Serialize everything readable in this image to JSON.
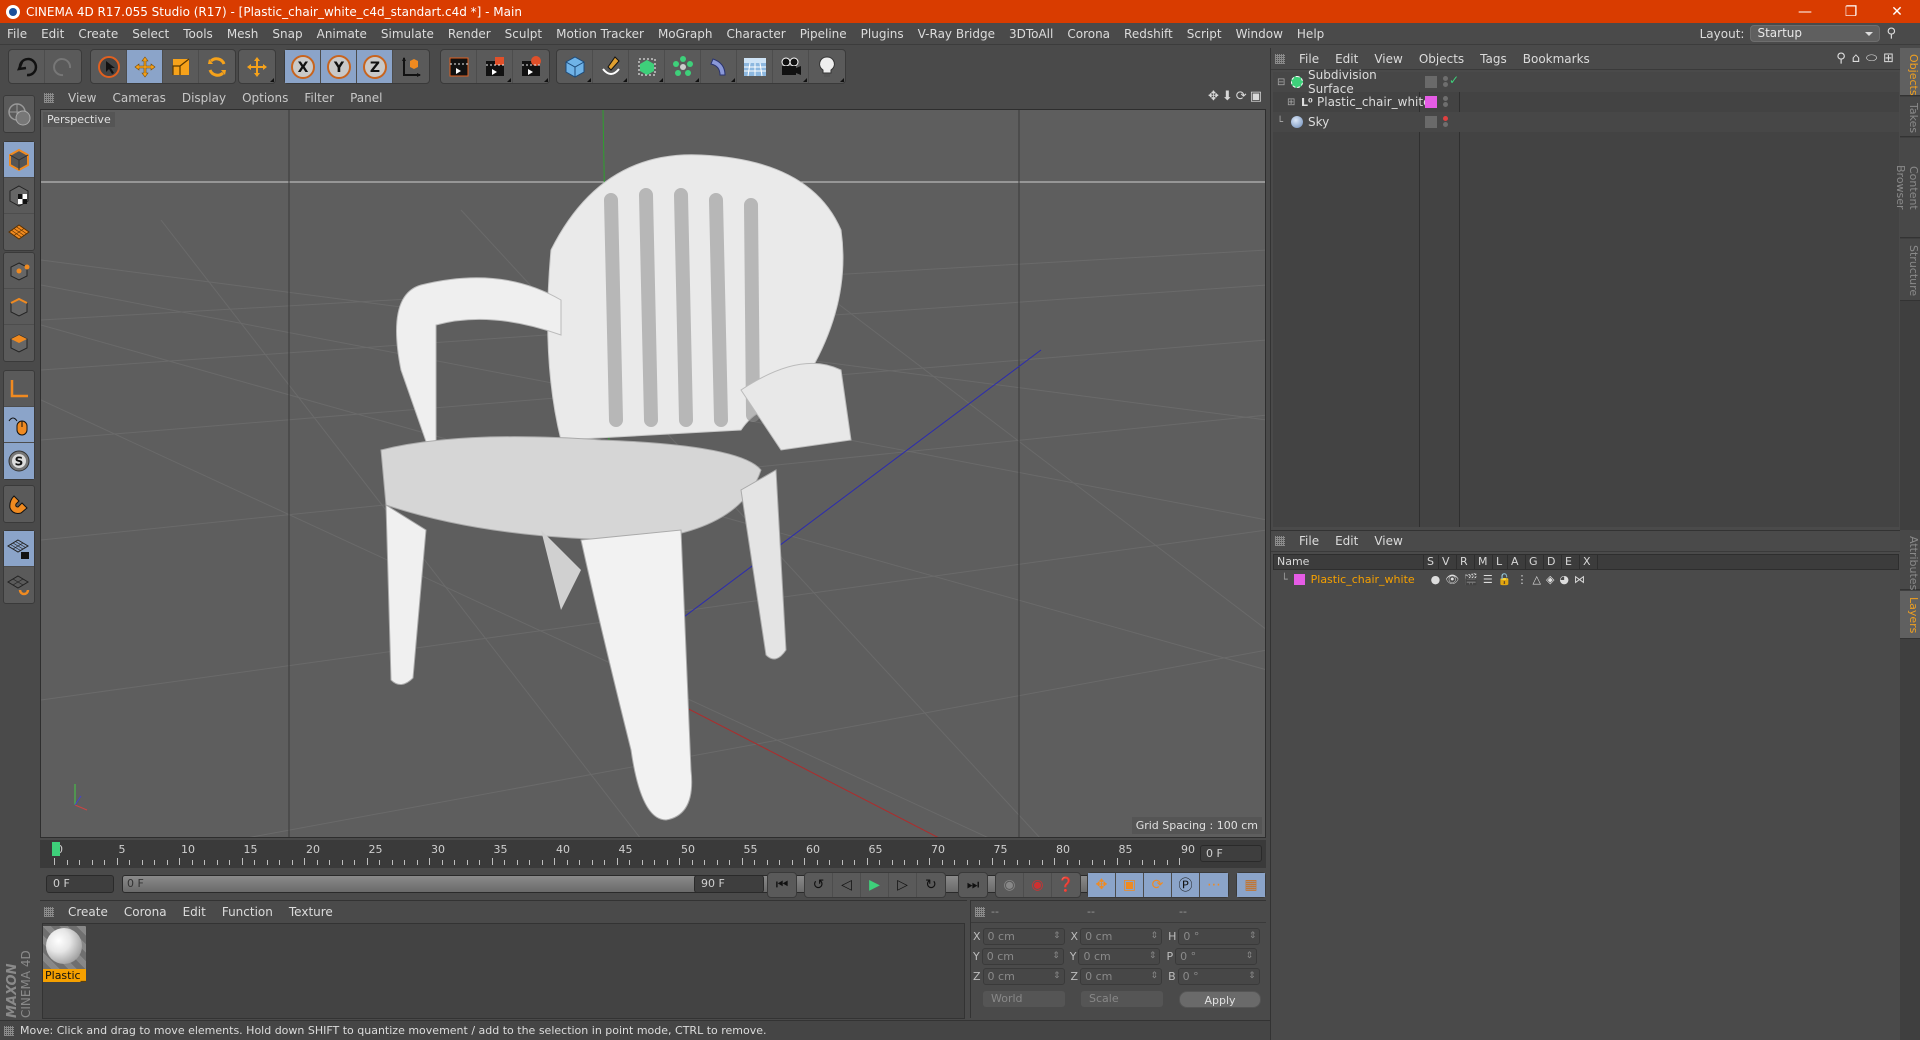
{
  "window": {
    "title": "CINEMA 4D R17.055 Studio (R17) - [Plastic_chair_white_c4d_standart.c4d *] - Main",
    "controls": [
      "minimize",
      "restore",
      "close"
    ],
    "accent_color": "#d93c00"
  },
  "menubar": {
    "items": [
      "File",
      "Edit",
      "Create",
      "Select",
      "Tools",
      "Mesh",
      "Snap",
      "Animate",
      "Simulate",
      "Render",
      "Sculpt",
      "Motion Tracker",
      "MoGraph",
      "Character",
      "Pipeline",
      "Plugins",
      "V-Ray Bridge",
      "3DToAll",
      "Corona",
      "Redshift",
      "Script",
      "Window",
      "Help"
    ],
    "layout_label": "Layout:",
    "layout_value": "Startup"
  },
  "toolbar": {
    "groups": [
      {
        "tools": [
          {
            "name": "undo-icon"
          },
          {
            "name": "redo-icon",
            "disabled": true
          }
        ]
      },
      {
        "tools": [
          {
            "name": "live-selection-icon"
          },
          {
            "name": "move-icon",
            "active": true
          },
          {
            "name": "scale-icon"
          },
          {
            "name": "rotate-icon"
          }
        ]
      },
      {
        "tools": [
          {
            "name": "recent-tool-icon"
          }
        ]
      },
      {
        "tools": [
          {
            "name": "x-axis-lock-icon",
            "label": "X",
            "active": true
          },
          {
            "name": "y-axis-lock-icon",
            "label": "Y",
            "active": true
          },
          {
            "name": "z-axis-lock-icon",
            "label": "Z",
            "active": true
          },
          {
            "name": "coordinate-system-icon"
          }
        ]
      },
      {
        "tools": [
          {
            "name": "render-view-icon"
          },
          {
            "name": "render-picture-viewer-icon"
          },
          {
            "name": "render-settings-icon"
          }
        ]
      },
      {
        "tools": [
          {
            "name": "cube-primitive-icon"
          },
          {
            "name": "pen-spline-icon"
          },
          {
            "name": "subdivision-surface-icon"
          },
          {
            "name": "array-cloner-icon"
          },
          {
            "name": "deformer-bend-icon"
          },
          {
            "name": "floor-environment-icon"
          },
          {
            "name": "camera-icon"
          },
          {
            "name": "light-icon"
          }
        ]
      }
    ]
  },
  "left_tools": [
    {
      "name": "make-editable-icon"
    },
    {
      "name": "model-mode-icon",
      "active": true
    },
    {
      "name": "texture-mode-icon"
    },
    {
      "name": "workplane-mode-icon"
    },
    {
      "name": "points-mode-icon"
    },
    {
      "name": "edges-mode-icon"
    },
    {
      "name": "polygons-mode-icon"
    },
    {
      "name": "axis-mode-icon"
    },
    {
      "name": "tweak-mode-icon",
      "active": true
    },
    {
      "name": "solo-mode-icon",
      "label": "S",
      "active": true
    },
    {
      "name": "snap-magnet-icon"
    },
    {
      "name": "workplane-lock-icon",
      "active": true
    },
    {
      "name": "workplane-align-icon"
    }
  ],
  "viewport": {
    "menu": [
      "View",
      "Cameras",
      "Display",
      "Options",
      "Filter",
      "Panel"
    ],
    "camera_label": "Perspective",
    "grid_spacing": "Grid Spacing : 100 cm",
    "nav_icons": [
      "pan-icon",
      "dolly-icon",
      "orbit-icon",
      "maximize-view-icon"
    ]
  },
  "object_manager": {
    "menu": [
      "File",
      "Edit",
      "View",
      "Objects",
      "Tags",
      "Bookmarks"
    ],
    "objects": [
      {
        "name": "Subdivision Surface",
        "icon": "subdivision-surface-icon",
        "expanded": true,
        "indent": 0,
        "enabled_check": true,
        "tag": "layer-tag"
      },
      {
        "name": "Plastic_chair_white",
        "icon": "null-object-icon",
        "expanded": false,
        "indent": 1,
        "tag_color": "#e65ce6"
      },
      {
        "name": "Sky",
        "icon": "sky-icon",
        "indent": 0,
        "tag": "layer-tag",
        "render_dot": "red"
      }
    ]
  },
  "layer_manager": {
    "menu": [
      "File",
      "Edit",
      "View"
    ],
    "columns": [
      "Name",
      "S",
      "V",
      "R",
      "M",
      "L",
      "A",
      "G",
      "D",
      "E",
      "X"
    ],
    "layers": [
      {
        "name": "Plastic_chair_white",
        "color": "#e65ce6"
      }
    ]
  },
  "side_tabs": {
    "top": [
      {
        "label": "Objects",
        "active": true
      },
      {
        "label": "Takes",
        "active": false
      },
      {
        "label": "Content Browser",
        "active": false
      },
      {
        "label": "Structure",
        "active": false
      }
    ],
    "bottom": [
      {
        "label": "Attributes",
        "active": false
      },
      {
        "label": "Layers",
        "active": true
      }
    ]
  },
  "timeline": {
    "ticks": [
      "0",
      "5",
      "10",
      "15",
      "20",
      "25",
      "30",
      "35",
      "40",
      "45",
      "50",
      "55",
      "60",
      "65",
      "70",
      "75",
      "80",
      "85",
      "90"
    ],
    "current_frame": "0 F",
    "start_field": "0 F",
    "range_start": "0 F",
    "range_end": "90 F",
    "end_field": "90 F",
    "playhead_frame": 0,
    "max_frame": 90
  },
  "transport": {
    "playback": [
      "go-to-start-icon",
      "previous-key-icon",
      "previous-frame-icon",
      "play-icon",
      "next-frame-icon",
      "next-key-icon",
      "go-to-end-icon"
    ],
    "keying": [
      "motion-record-icon",
      "record-active-objects-icon",
      "autokeying-icon"
    ],
    "key_tracks": [
      "key-position-icon",
      "key-scale-icon",
      "key-rotation-icon",
      "key-parameter-icon",
      "key-pla-icon"
    ],
    "timeline_button": "timeline-window-icon"
  },
  "material_manager": {
    "menu": [
      "Create",
      "Corona",
      "Edit",
      "Function",
      "Texture"
    ],
    "materials": [
      {
        "name": "Plastic_v",
        "selected": true
      }
    ]
  },
  "coordinate_manager": {
    "headers": [
      "--",
      "--",
      "--"
    ],
    "rows": [
      {
        "pos_label": "X",
        "pos": "0 cm",
        "size_label": "X",
        "size": "0 cm",
        "rot_label": "H",
        "rot": "0 °"
      },
      {
        "pos_label": "Y",
        "pos": "0 cm",
        "size_label": "Y",
        "size": "0 cm",
        "rot_label": "P",
        "rot": "0 °"
      },
      {
        "pos_label": "Z",
        "pos": "0 cm",
        "size_label": "Z",
        "size": "0 cm",
        "rot_label": "B",
        "rot": "0 °"
      }
    ],
    "coord_system": "World",
    "size_mode": "Scale",
    "apply_label": "Apply"
  },
  "statusbar": {
    "text": "Move: Click and drag to move elements. Hold down SHIFT to quantize movement / add to the selection in point mode, CTRL to remove."
  },
  "brand": {
    "maxon": "MAXON",
    "product": "CINEMA 4D"
  }
}
